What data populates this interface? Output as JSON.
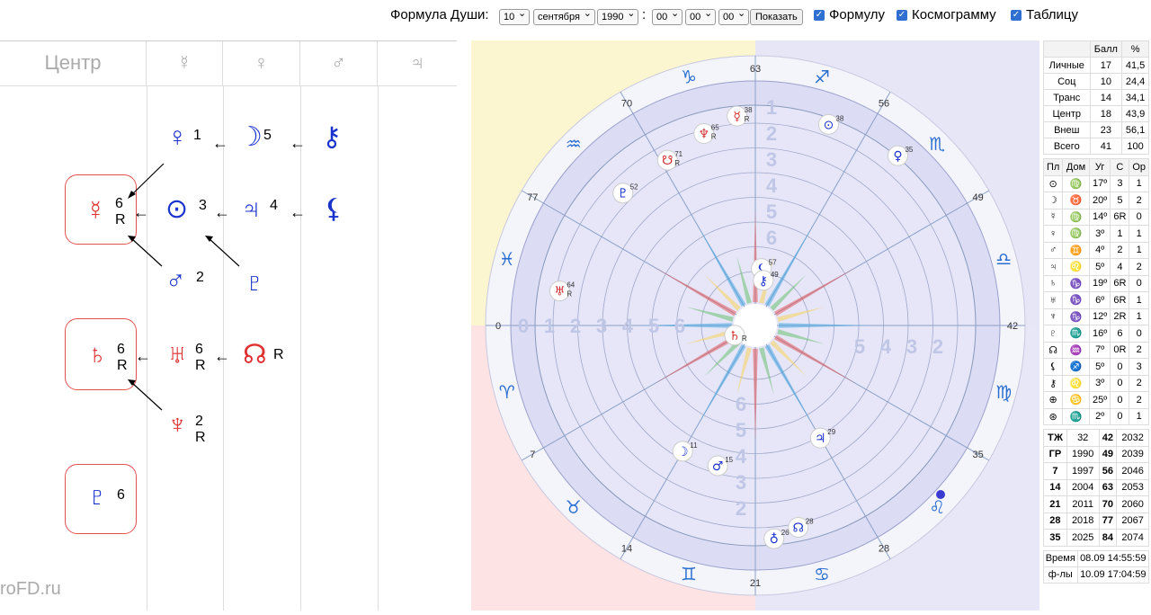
{
  "topbar": {
    "label": "Формула Души:",
    "day": "10",
    "month": "сентября",
    "year": "1990",
    "colon": ":",
    "hour": "00",
    "minute": "00",
    "second": "00",
    "show_button": "Показать",
    "check_formula": "Формулу",
    "check_cosmogram": "Космограмму",
    "check_table": "Таблицу"
  },
  "formula": {
    "columns": [
      "Центр",
      "☿",
      "♀",
      "♂",
      "♃"
    ],
    "nodes": {
      "venus": {
        "glyph": "♀",
        "num": "1",
        "r": ""
      },
      "moon": {
        "glyph": "☽",
        "num": "5",
        "r": ""
      },
      "chiron": {
        "glyph": "⚷",
        "num": "",
        "r": ""
      },
      "mercury": {
        "glyph": "☿",
        "num": "6",
        "r": "R"
      },
      "sun": {
        "glyph": "⊙",
        "num": "3",
        "r": ""
      },
      "jupiter": {
        "glyph": "♃",
        "num": "4",
        "r": ""
      },
      "lilith": {
        "glyph": "⚸",
        "num": "",
        "r": ""
      },
      "mars": {
        "glyph": "♂",
        "num": "2",
        "r": ""
      },
      "pluto_small": {
        "glyph": "♇",
        "num": "",
        "r": ""
      },
      "saturn": {
        "glyph": "♄",
        "num": "6",
        "r": "R"
      },
      "uranus": {
        "glyph": "♅",
        "num": "6",
        "r": "R"
      },
      "node": {
        "glyph": "☊",
        "num": "",
        "r": "R"
      },
      "neptune": {
        "glyph": "♆",
        "num": "2",
        "r": "R"
      },
      "pluto": {
        "glyph": "♇",
        "num": "6",
        "r": ""
      }
    },
    "watermark": "roFD.ru"
  },
  "cosmogram": {
    "degrees": [
      "63",
      "56",
      "49",
      "42",
      "35",
      "28",
      "21",
      "14",
      "7",
      "0",
      "77",
      "70"
    ],
    "signs": [
      "♑",
      "♐",
      "♏",
      "♎",
      "♍",
      "♌",
      "♋",
      "♊",
      "♉",
      "♈",
      "♓",
      "♒"
    ],
    "planets": [
      {
        "g": "☋",
        "n": "71",
        "r": "R"
      },
      {
        "g": "♆",
        "n": "65",
        "r": "R"
      },
      {
        "g": "⚸",
        "n": "57",
        "r": ""
      },
      {
        "g": "⚷",
        "n": "49",
        "r": ""
      },
      {
        "g": "♄",
        "n": "",
        "r": "R"
      },
      {
        "g": "♅",
        "n": "64",
        "r": "R"
      },
      {
        "g": "♇",
        "n": "52",
        "r": ""
      },
      {
        "g": "☿",
        "n": "38",
        "r": "R"
      },
      {
        "g": "⊙",
        "n": "38",
        "r": ""
      },
      {
        "g": "♀",
        "n": "35",
        "r": ""
      },
      {
        "g": "☽",
        "n": "11",
        "r": ""
      },
      {
        "g": "♃",
        "n": "29",
        "r": ""
      },
      {
        "g": "♂",
        "n": "15",
        "r": ""
      },
      {
        "g": "☊",
        "n": "28",
        "r": ""
      },
      {
        "g": "♁",
        "n": "26",
        "r": ""
      }
    ],
    "house_numbers_top": [
      "1",
      "2",
      "3",
      "4",
      "5",
      "6"
    ],
    "house_numbers_left": [
      "0",
      "1",
      "2",
      "3",
      "4",
      "5",
      "6"
    ],
    "house_numbers_right": [
      "5",
      "4",
      "3",
      "2"
    ],
    "house_numbers_bottom": [
      "6",
      "5",
      "4",
      "3",
      "2"
    ]
  },
  "summary": {
    "head": [
      "",
      "Балл",
      "%"
    ],
    "rows": [
      [
        "Личные",
        "17",
        "41,5"
      ],
      [
        "Соц",
        "10",
        "24,4"
      ],
      [
        "Транс",
        "14",
        "34,1"
      ],
      [
        "Центр",
        "18",
        "43,9"
      ],
      [
        "Внеш",
        "23",
        "56,1"
      ],
      [
        "Всего",
        "41",
        "100"
      ]
    ]
  },
  "planets_table": {
    "head": [
      "Пл",
      "Дом",
      "Уг",
      "С",
      "Ор"
    ],
    "rows": [
      [
        "⊙",
        "♍",
        "17º",
        "3",
        "1"
      ],
      [
        "☽",
        "♉",
        "20º",
        "5",
        "2"
      ],
      [
        "☿",
        "♍",
        "14º",
        "6R",
        "0"
      ],
      [
        "♀",
        "♍",
        "3º",
        "1",
        "1"
      ],
      [
        "♂",
        "♊",
        "4º",
        "2",
        "1"
      ],
      [
        "♃",
        "♌",
        "5º",
        "4",
        "2"
      ],
      [
        "♄",
        "♑",
        "19º",
        "6R",
        "0"
      ],
      [
        "♅",
        "♑",
        "6º",
        "6R",
        "1"
      ],
      [
        "♆",
        "♑",
        "12º",
        "2R",
        "1"
      ],
      [
        "♇",
        "♏",
        "16º",
        "6",
        "0"
      ],
      [
        "☊",
        "♒",
        "7º",
        "0R",
        "2"
      ],
      [
        "⚸",
        "♐",
        "5º",
        "0",
        "3"
      ],
      [
        "⚷",
        "♌",
        "3º",
        "0",
        "2"
      ],
      [
        "⊕",
        "♋",
        "25º",
        "0",
        "2"
      ],
      [
        "⊛",
        "♏",
        "2º",
        "0",
        "1"
      ]
    ]
  },
  "years_table": {
    "rows": [
      [
        "ТЖ",
        "32",
        "42",
        "2032"
      ],
      [
        "ГР",
        "1990",
        "49",
        "2039"
      ],
      [
        "7",
        "1997",
        "56",
        "2046"
      ],
      [
        "14",
        "2004",
        "63",
        "2053"
      ],
      [
        "21",
        "2011",
        "70",
        "2060"
      ],
      [
        "28",
        "2018",
        "77",
        "2067"
      ],
      [
        "35",
        "2025",
        "84",
        "2074"
      ]
    ]
  },
  "time_table": {
    "rows": [
      [
        "Время",
        "08.09 14:55:59"
      ],
      [
        "ф-лы",
        "10.09 17:04:59"
      ]
    ]
  }
}
